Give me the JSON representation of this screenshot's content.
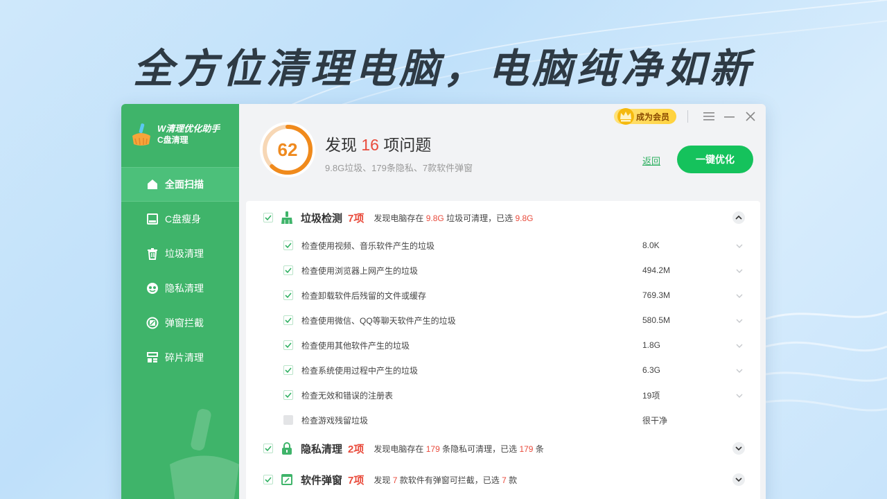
{
  "hero": {
    "title": "全方位清理电脑，电脑纯净如新"
  },
  "app": {
    "name": "W清理优化助手",
    "subtitle": "C盘清理"
  },
  "sidebar": {
    "items": [
      {
        "label": "全面扫描",
        "icon": "home-icon",
        "active": true
      },
      {
        "label": "C盘瘦身",
        "icon": "disk-icon",
        "active": false
      },
      {
        "label": "垃圾清理",
        "icon": "trash-icon",
        "active": false
      },
      {
        "label": "隐私清理",
        "icon": "privacy-icon",
        "active": false
      },
      {
        "label": "弹窗拦截",
        "icon": "popup-block-icon",
        "active": false
      },
      {
        "label": "碎片清理",
        "icon": "fragment-icon",
        "active": false
      }
    ]
  },
  "topbar": {
    "vip_label": "成为会员"
  },
  "summary": {
    "score": "62",
    "title_prefix": "发现",
    "issue_count": "16",
    "title_suffix": "项问题",
    "subtitle": "9.8G垃圾、179条隐私、7款软件弹窗",
    "back_label": "返回",
    "optimize_label": "一键优化"
  },
  "categories": [
    {
      "name": "垃圾检测",
      "count": "7项",
      "desc_prefix": "发现电脑存在",
      "desc_value": "9.8G",
      "desc_middle": "垃圾可清理，已选",
      "desc_selected": "9.8G",
      "desc_suffix": "",
      "expanded": true,
      "items": [
        {
          "label": "检查使用视频、音乐软件产生的垃圾",
          "size": "8.0K",
          "checked": true
        },
        {
          "label": "检查使用浏览器上网产生的垃圾",
          "size": "494.2M",
          "checked": true
        },
        {
          "label": "检查卸载软件后残留的文件或缓存",
          "size": "769.3M",
          "checked": true
        },
        {
          "label": "检查使用微信、QQ等聊天软件产生的垃圾",
          "size": "580.5M",
          "checked": true
        },
        {
          "label": "检查使用其他软件产生的垃圾",
          "size": "1.8G",
          "checked": true
        },
        {
          "label": "检查系统使用过程中产生的垃圾",
          "size": "6.3G",
          "checked": true
        },
        {
          "label": "检查无效和错误的注册表",
          "size": "19项",
          "checked": true
        },
        {
          "label": "检查游戏残留垃圾",
          "size": "很干净",
          "checked": false
        }
      ]
    },
    {
      "name": "隐私清理",
      "count": "2项",
      "desc_prefix": "发现电脑存在",
      "desc_value": "179",
      "desc_middle": "条隐私可清理，已选",
      "desc_selected": "179",
      "desc_suffix": "条",
      "expanded": false
    },
    {
      "name": "软件弹窗",
      "count": "7项",
      "desc_prefix": "发现",
      "desc_value": "7",
      "desc_middle": "款软件有弹窗可拦截，已选",
      "desc_selected": "7",
      "desc_suffix": "款",
      "expanded": false
    }
  ],
  "colors": {
    "sidebar": "#3fb46a",
    "accent_green": "#15c25c",
    "highlight_red": "#e94b3c",
    "score_orange": "#ef8a1f"
  }
}
